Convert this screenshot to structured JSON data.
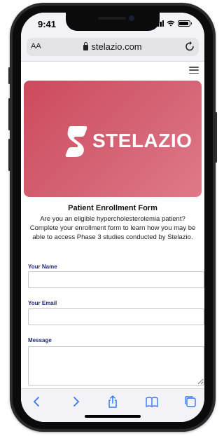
{
  "status_bar": {
    "time": "9:41"
  },
  "address_bar": {
    "text_size_label": "AA",
    "url": "stelazio.com"
  },
  "hero": {
    "brand_name": "STELAZIO",
    "background_color": "#d35f70"
  },
  "form": {
    "title": "Patient Enrollment Form",
    "intro": "Are you an eligible hypercholesterolemia patient? Complete your enrollment form to learn how you may be able to access Phase 3 studies conducted by Stelazio.",
    "fields": [
      {
        "label": "Your Name",
        "value": ""
      },
      {
        "label": "Your Email",
        "value": ""
      },
      {
        "label": "Message",
        "value": ""
      }
    ],
    "label_color": "#1e2a78"
  },
  "toolbar": {
    "icons": [
      "back-icon",
      "forward-icon",
      "share-icon",
      "bookmarks-icon",
      "tabs-icon"
    ],
    "accent_color": "#3478f6"
  }
}
